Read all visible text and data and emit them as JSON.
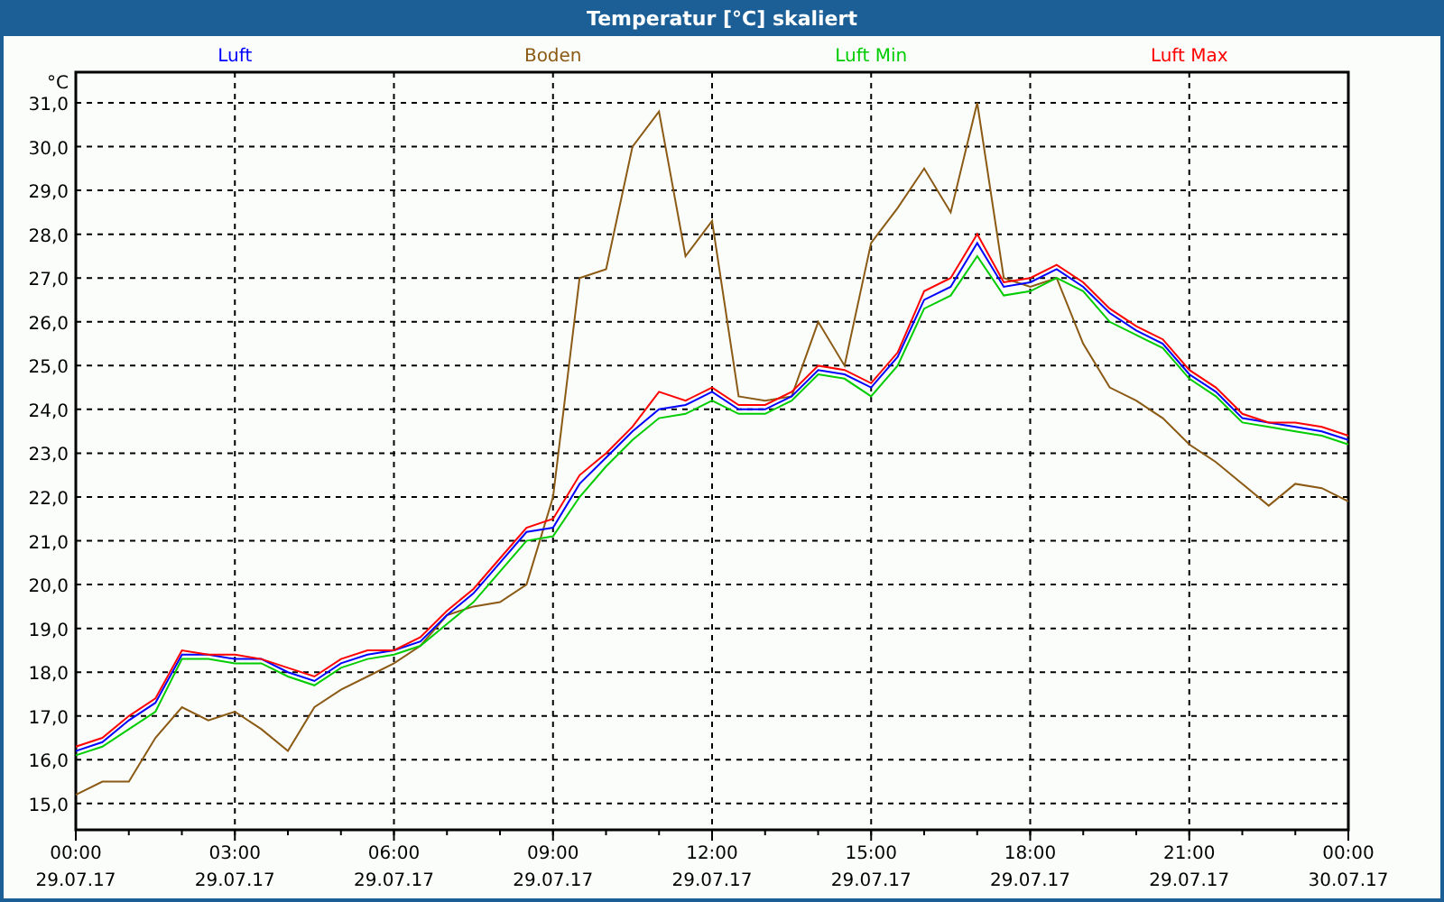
{
  "window": {
    "title": "Temperatur [°C] skaliert"
  },
  "chart": {
    "chart_data": {
      "type": "line",
      "ylabel": "°C",
      "categories": [
        "00:00 29.07.17",
        null,
        null,
        null,
        null,
        null,
        "03:00 29.07.17",
        null,
        null,
        null,
        null,
        null,
        "06:00 29.07.17",
        null,
        null,
        null,
        null,
        null,
        "09:00 29.07.17",
        null,
        null,
        null,
        null,
        null,
        "12:00 29.07.17",
        null,
        null,
        null,
        null,
        null,
        "15:00 29.07.17",
        null,
        null,
        null,
        null,
        null,
        "18:00 29.07.17",
        null,
        null,
        null,
        null,
        null,
        "21:00 29.07.17",
        null,
        null,
        null,
        null,
        null,
        "00:00 30.07.17"
      ],
      "ylim": [
        14.4,
        31.7
      ],
      "grid": true,
      "yticks": [
        {
          "value": 15,
          "label": "15,0"
        },
        {
          "value": 16,
          "label": "16,0"
        },
        {
          "value": 17,
          "label": "17,0"
        },
        {
          "value": 18,
          "label": "18,0"
        },
        {
          "value": 19,
          "label": "19,0"
        },
        {
          "value": 20,
          "label": "20,0"
        },
        {
          "value": 21,
          "label": "21,0"
        },
        {
          "value": 22,
          "label": "22,0"
        },
        {
          "value": 23,
          "label": "23,0"
        },
        {
          "value": 24,
          "label": "24,0"
        },
        {
          "value": 25,
          "label": "25,0"
        },
        {
          "value": 26,
          "label": "26,0"
        },
        {
          "value": 27,
          "label": "27,0"
        },
        {
          "value": 28,
          "label": "28,0"
        },
        {
          "value": 29,
          "label": "29,0"
        },
        {
          "value": 30,
          "label": "30,0"
        },
        {
          "value": 31,
          "label": "31,0"
        }
      ],
      "series": [
        {
          "name": "Luft",
          "color": "#0000ff",
          "values": [
            16.2,
            16.4,
            16.9,
            17.3,
            18.4,
            18.4,
            18.3,
            18.3,
            18.0,
            17.8,
            18.2,
            18.4,
            18.5,
            18.7,
            19.3,
            19.8,
            20.5,
            21.2,
            21.3,
            22.3,
            22.9,
            23.5,
            24.0,
            24.1,
            24.4,
            24.0,
            24.0,
            24.3,
            24.9,
            24.8,
            24.5,
            25.2,
            26.5,
            26.8,
            27.8,
            26.8,
            26.9,
            27.2,
            26.8,
            26.2,
            25.8,
            25.5,
            24.8,
            24.4,
            23.8,
            23.7,
            23.6,
            23.5,
            23.3
          ]
        },
        {
          "name": "Boden",
          "color": "#8b5a14",
          "values": [
            15.2,
            15.5,
            15.5,
            16.5,
            17.2,
            16.9,
            17.1,
            16.7,
            16.2,
            17.2,
            17.6,
            17.9,
            18.2,
            18.6,
            19.3,
            19.5,
            19.6,
            20.0,
            22.0,
            27.0,
            27.2,
            30.0,
            30.8,
            27.5,
            28.3,
            24.3,
            24.2,
            24.3,
            26.0,
            25.0,
            27.8,
            28.6,
            29.5,
            28.5,
            31.0,
            27.0,
            26.8,
            27.0,
            25.5,
            24.5,
            24.2,
            23.8,
            23.2,
            22.8,
            22.3,
            21.8,
            22.3,
            22.2,
            21.9
          ]
        },
        {
          "name": "Luft Min",
          "color": "#00cc00",
          "values": [
            16.1,
            16.3,
            16.7,
            17.1,
            18.3,
            18.3,
            18.2,
            18.2,
            17.9,
            17.7,
            18.1,
            18.3,
            18.4,
            18.6,
            19.1,
            19.6,
            20.3,
            21.0,
            21.1,
            22.0,
            22.7,
            23.3,
            23.8,
            23.9,
            24.2,
            23.9,
            23.9,
            24.2,
            24.8,
            24.7,
            24.3,
            25.0,
            26.3,
            26.6,
            27.5,
            26.6,
            26.7,
            27.0,
            26.7,
            26.0,
            25.7,
            25.4,
            24.7,
            24.3,
            23.7,
            23.6,
            23.5,
            23.4,
            23.2
          ]
        },
        {
          "name": "Luft Max",
          "color": "#ff0000",
          "values": [
            16.3,
            16.5,
            17.0,
            17.4,
            18.5,
            18.4,
            18.4,
            18.3,
            18.1,
            17.9,
            18.3,
            18.5,
            18.5,
            18.8,
            19.4,
            19.9,
            20.6,
            21.3,
            21.5,
            22.5,
            23.0,
            23.6,
            24.4,
            24.2,
            24.5,
            24.1,
            24.1,
            24.4,
            25.0,
            24.9,
            24.6,
            25.3,
            26.7,
            27.0,
            28.0,
            26.9,
            27.0,
            27.3,
            26.9,
            26.3,
            25.9,
            25.6,
            24.9,
            24.5,
            23.9,
            23.7,
            23.7,
            23.6,
            23.4
          ]
        }
      ]
    }
  }
}
